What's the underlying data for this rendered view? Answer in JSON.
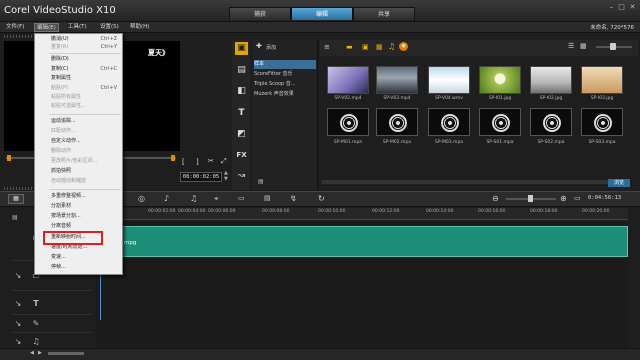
{
  "title_bar": {
    "app_title": "Corel VideoStudio X10",
    "tabs": [
      {
        "label": "捕获"
      },
      {
        "label": "编辑"
      },
      {
        "label": "共享"
      }
    ],
    "window_controls": {
      "minimize_icon": "minimize-icon",
      "maximize_icon": "maximize-icon",
      "close_icon": "close-icon"
    }
  },
  "menubar": {
    "items": [
      {
        "label": "文件(F)"
      },
      {
        "label": "编辑(E)"
      },
      {
        "label": "工具(T)"
      },
      {
        "label": "设置(S)"
      },
      {
        "label": "帮助(H)"
      }
    ],
    "project_info": "未命名, 720*576"
  },
  "preview": {
    "overlay_text": "夏天》",
    "timecode": "00:00:02:05",
    "buttons": {
      "mark_in": "[",
      "mark_out": "]"
    }
  },
  "edit_menu": {
    "items": [
      {
        "label": "撤消(U)",
        "shortcut": "Ctrl+Z",
        "disabled": false
      },
      {
        "label": "重复(R)",
        "shortcut": "Ctrl+Y",
        "disabled": true
      },
      {
        "label": "删除(D)",
        "shortcut": "",
        "disabled": false
      },
      {
        "label": "复制(C)",
        "shortcut": "Ctrl+C",
        "disabled": false
      },
      {
        "label": "复制属性",
        "shortcut": "",
        "disabled": false
      },
      {
        "label": "粘贴(P)",
        "shortcut": "Ctrl+V",
        "disabled": true
      },
      {
        "label": "粘贴所有属性",
        "shortcut": "",
        "disabled": true
      },
      {
        "label": "粘贴可选属性...",
        "shortcut": "",
        "disabled": true
      },
      {
        "label": "运动追踪...",
        "shortcut": "",
        "disabled": false
      },
      {
        "label": "匹配动作...",
        "shortcut": "",
        "disabled": true
      },
      {
        "label": "自定义动作...",
        "shortcut": "",
        "disabled": false
      },
      {
        "label": "删除动作",
        "shortcut": "",
        "disabled": true
      },
      {
        "label": "更改照片/色彩区间...",
        "shortcut": "",
        "disabled": true
      },
      {
        "label": "抓拍快照",
        "shortcut": "",
        "disabled": false
      },
      {
        "label": "自动摇动和缩放",
        "shortcut": "",
        "disabled": true
      },
      {
        "label": "多重修整视频...",
        "shortcut": "",
        "disabled": false
      },
      {
        "label": "分割素材",
        "shortcut": "",
        "disabled": false
      },
      {
        "label": "按场景分割...",
        "shortcut": "",
        "disabled": false
      },
      {
        "label": "分离音频",
        "shortcut": "",
        "disabled": false
      },
      {
        "label": "重新映射时间...",
        "shortcut": "",
        "disabled": false
      },
      {
        "label": "速度/时间流逝...",
        "shortcut": "",
        "disabled": false
      },
      {
        "label": "变速...",
        "shortcut": "",
        "disabled": false
      },
      {
        "label": "停帧...",
        "shortcut": "",
        "disabled": false
      }
    ]
  },
  "library": {
    "add_label": "添加",
    "folders": [
      {
        "label": "样本",
        "selected": true
      },
      {
        "label": "ScoreFitter 音乐",
        "selected": false
      },
      {
        "label": "Triple Scoop 音...",
        "selected": false
      },
      {
        "label": "Muzerk 声音效果",
        "selected": false
      }
    ],
    "thumbnails_row1": [
      {
        "label": "SP-V02.mp4",
        "icon": "video-thumbnail"
      },
      {
        "label": "SP-V03.mp4",
        "icon": "video-thumbnail"
      },
      {
        "label": "SP-V04.wmv",
        "icon": "video-thumbnail"
      },
      {
        "label": "SP-I01.jpg",
        "icon": "image-thumbnail"
      },
      {
        "label": "SP-I02.jpg",
        "icon": "image-thumbnail"
      },
      {
        "label": "SP-I03.jpg",
        "icon": "image-thumbnail"
      }
    ],
    "thumbnails_row2": [
      {
        "label": "SP-M01.mpa",
        "icon": "audio-disc-icon"
      },
      {
        "label": "SP-M02.mpa",
        "icon": "audio-disc-icon"
      },
      {
        "label": "SP-M03.mpa",
        "icon": "audio-disc-icon"
      },
      {
        "label": "SP-S01.mpa",
        "icon": "audio-disc-icon"
      },
      {
        "label": "SP-S02.mpa",
        "icon": "audio-disc-icon"
      },
      {
        "label": "SP-S03.mpa",
        "icon": "audio-disc-icon"
      }
    ],
    "browse_button": "浏览"
  },
  "timeline": {
    "ruler_ticks": [
      "00:00:02:00",
      "00:00:04:00",
      "00:00:06:00",
      "00:00:08:00",
      "00:00:10:00",
      "00:00:12:00",
      "00:00:14:00",
      "00:00:16:00",
      "00:00:18:00",
      "00:00:20:00"
    ],
    "timecode": "0:04:56:13",
    "clip_name": "mpg"
  },
  "colors": {
    "clip_fill": "#1d8f78",
    "active_tab": "#3a8fc8",
    "highlight_box": "#e02020"
  }
}
